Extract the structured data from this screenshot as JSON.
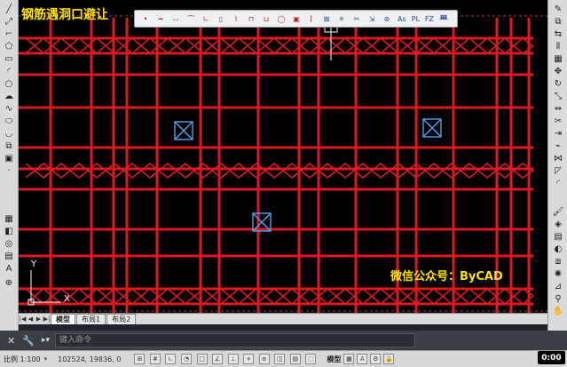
{
  "title": "钢筋遇洞口避让",
  "watermark": "微信公众号：ByCAD",
  "ucs": {
    "y_label": "Y",
    "x_label": "X"
  },
  "floating_toolbar": {
    "text_items": [
      "As",
      "PL",
      "FZ"
    ]
  },
  "layout_tabs": [
    {
      "label": "模型",
      "active": true
    },
    {
      "label": "布局1",
      "active": false
    },
    {
      "label": "布局2",
      "active": false
    }
  ],
  "command": {
    "placeholder": "键入命令"
  },
  "status": {
    "scale": "比例 1:100",
    "coords": "102524, 19836, 0",
    "model": "模型",
    "clock": "0:00"
  },
  "colors": {
    "canvas_bg": "#000000",
    "rebar": "#e0191e",
    "hole": "#4da3e8",
    "title": "#ffe400"
  }
}
